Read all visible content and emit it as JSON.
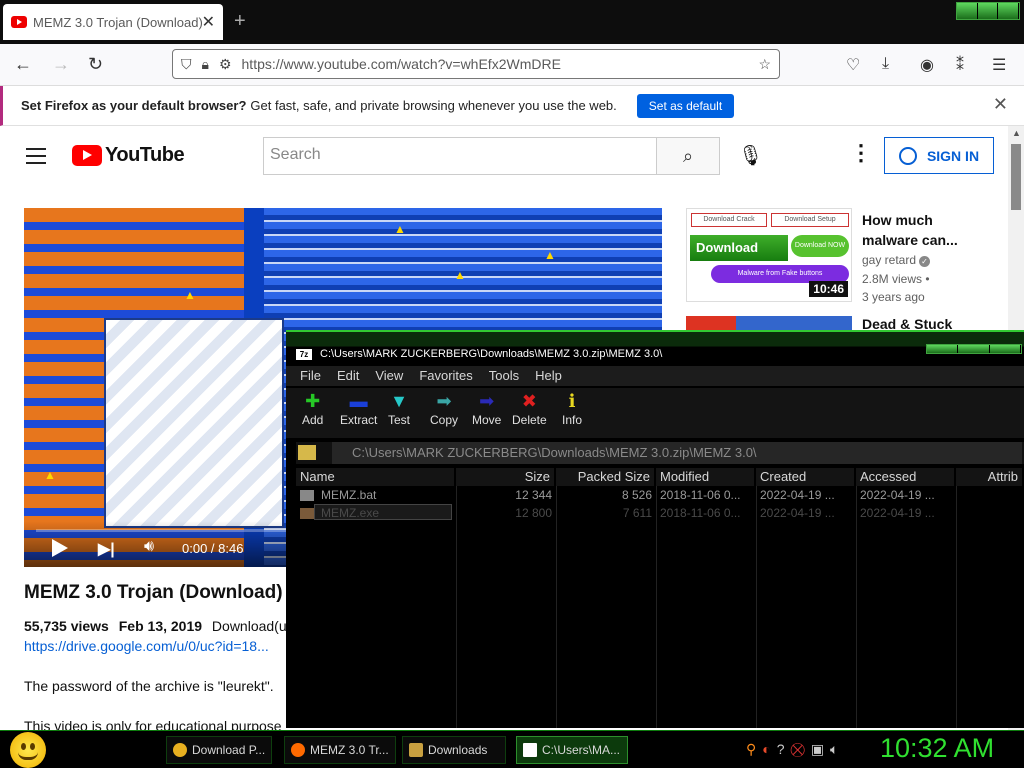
{
  "browser": {
    "tab_title": "MEMZ 3.0 Trojan (Download) -",
    "tab_close": "✕",
    "new_tab": "+",
    "url": "https://www.youtube.com/watch?v=whEfx2WmDRE",
    "notification": {
      "bold": "Set Firefox as your default browser?",
      "text": "Get fast, safe, and private browsing whenever you use the web.",
      "button": "Set as default"
    }
  },
  "youtube": {
    "logo": "YouTube",
    "search_placeholder": "Search",
    "sign_in": "SIGN IN",
    "video": {
      "time": "0:00 / 8:46",
      "title": "MEMZ 3.0 Trojan (Download)",
      "views": "55,735 views",
      "date": "Feb 13, 2019",
      "desc_start": "Download(us",
      "link": "https://drive.google.com/u/0/uc?id=18...",
      "password_line": "The password of the archive is \"leurekt\".",
      "edu_line": "This video is only for educational purpose"
    },
    "sidebar": [
      {
        "title": "How much malware can...",
        "channel": "gay retard",
        "views": "2.8M views •",
        "age": "3 years ago",
        "duration": "10:46",
        "thumb_labels": [
          "Download Crack",
          "Download Setup",
          "Download",
          "Download NOW",
          "Malware from Fake buttons"
        ]
      },
      {
        "title": "Dead & Stuck"
      }
    ]
  },
  "zip": {
    "title": "C:\\Users\\MARK ZUCKERBERG\\Downloads\\MEMZ 3.0.zip\\MEMZ 3.0\\",
    "app_icon": "7z",
    "menu": [
      "File",
      "Edit",
      "View",
      "Favorites",
      "Tools",
      "Help"
    ],
    "tools": [
      {
        "label": "Add",
        "color": "#26c826"
      },
      {
        "label": "Extract",
        "color": "#1a3fd8"
      },
      {
        "label": "Test",
        "color": "#26c8c8"
      },
      {
        "label": "Copy",
        "color": "#3aa6a6"
      },
      {
        "label": "Move",
        "color": "#2a2ab8"
      },
      {
        "label": "Delete",
        "color": "#e02020"
      },
      {
        "label": "Info",
        "color": "#e8d820"
      }
    ],
    "path": "C:\\Users\\MARK ZUCKERBERG\\Downloads\\MEMZ 3.0.zip\\MEMZ 3.0\\",
    "columns": [
      "Name",
      "Size",
      "Packed Size",
      "Modified",
      "Created",
      "Accessed",
      "Attrib"
    ],
    "rows": [
      {
        "name": "MEMZ.bat",
        "size": "12 344",
        "packed": "8 526",
        "modified": "2018-11-06 0...",
        "created": "2022-04-19 ...",
        "accessed": "2022-04-19 ..."
      },
      {
        "name": "MEMZ.exe",
        "size": "12 800",
        "packed": "7 611",
        "modified": "2018-11-06 0...",
        "created": "2022-04-19 ...",
        "accessed": "2022-04-19 ..."
      }
    ]
  },
  "taskbar": {
    "tasks": [
      {
        "label": "Download P...",
        "icon_color": "#e8b020"
      },
      {
        "label": "MEMZ 3.0 Tr...",
        "icon_color": "#ff6a00"
      },
      {
        "label": "Downloads",
        "icon_color": "#c8a040"
      },
      {
        "label": "C:\\Users\\MA...",
        "icon_color": "#ffffff"
      }
    ],
    "clock": "10:32 AM"
  },
  "colors": {
    "accent_green": "#30e030",
    "youtube_red": "#ff0000",
    "link_blue": "#065fd4",
    "firefox_button": "#0061e0"
  }
}
